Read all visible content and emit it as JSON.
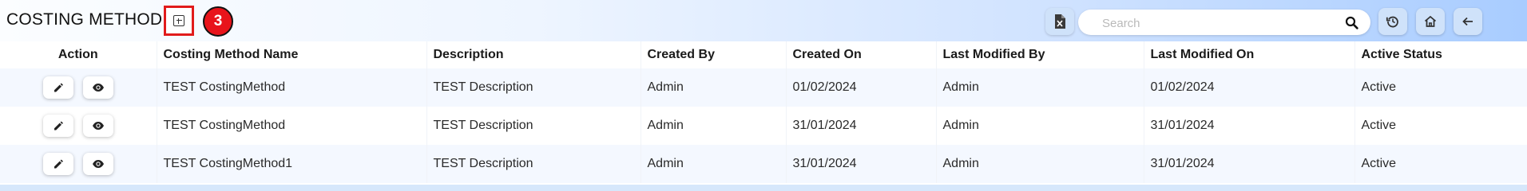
{
  "page": {
    "title": "COSTING METHOD",
    "badge_count": "3"
  },
  "search": {
    "placeholder": "Search"
  },
  "toolbar": {
    "icons": [
      "excel-export-icon",
      "search-icon",
      "refresh-icon",
      "home-icon",
      "back-arrow-icon"
    ]
  },
  "table": {
    "columns": [
      "Action",
      "Costing Method Name",
      "Description",
      "Created By",
      "Created On",
      "Last Modified By",
      "Last Modified On",
      "Active Status"
    ],
    "rows": [
      [
        "TEST CostingMethod",
        "TEST Description",
        "Admin",
        "01/02/2024",
        "Admin",
        "01/02/2024",
        "Active"
      ],
      [
        "TEST CostingMethod",
        "TEST Description",
        "Admin",
        "31/01/2024",
        "Admin",
        "31/01/2024",
        "Active"
      ],
      [
        "TEST CostingMethod1",
        "TEST Description",
        "Admin",
        "31/01/2024",
        "Admin",
        "31/01/2024",
        "Active"
      ]
    ]
  },
  "colors": {
    "highlight_border": "#e11b1b",
    "badge": "#e8141b",
    "row_stripe": "#f4f8ff",
    "header_gradient_end": "#a8ccff"
  }
}
